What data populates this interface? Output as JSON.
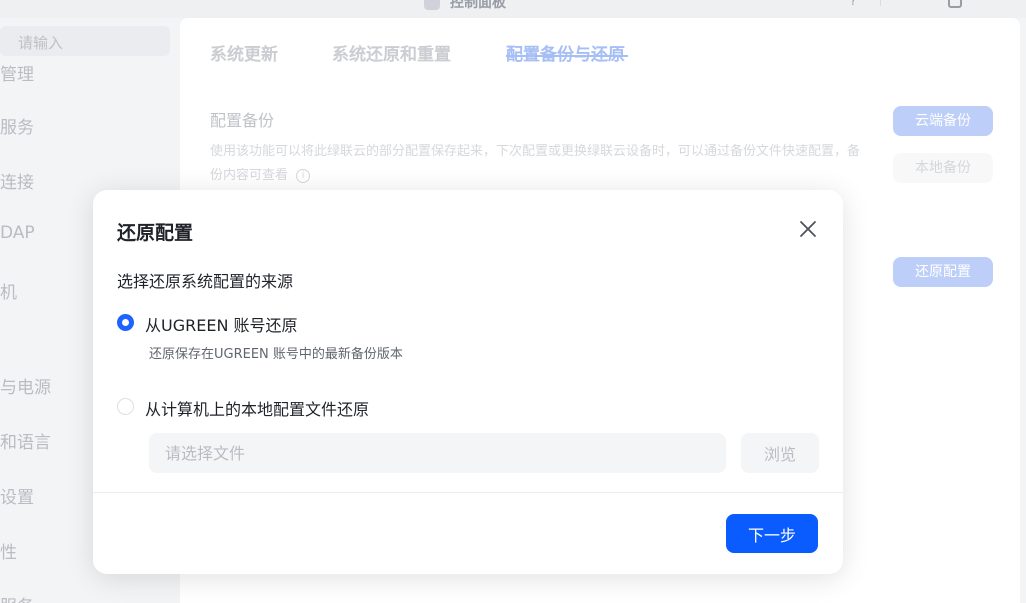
{
  "window": {
    "title": "控制面板"
  },
  "sidebar": {
    "search_placeholder": "请输入",
    "items": [
      {
        "label": "管理"
      },
      {
        "label": "服务"
      },
      {
        "label": "连接"
      },
      {
        "label": "DAP"
      },
      {
        "label": "机"
      },
      {
        "label": "与电源"
      },
      {
        "label": "和语言"
      },
      {
        "label": "设置"
      },
      {
        "label": "性"
      },
      {
        "label": "服务"
      }
    ]
  },
  "tabs": [
    {
      "label": "系统更新"
    },
    {
      "label": "系统还原和重置"
    },
    {
      "label": "配置备份与还原",
      "active": true
    }
  ],
  "backup": {
    "title": "配置备份",
    "description": "使用该功能可以将此绿联云的部分配置保存起来，下次配置或更换绿联云设备时，可以通过备份文件快速配置，备份内容可查看",
    "cloud_button": "云端备份",
    "local_button": "本地备份",
    "restore_button": "还原配置"
  },
  "modal": {
    "title": "还原配置",
    "subtitle": "选择还原系统配置的来源",
    "options": [
      {
        "label": "从UGREEN 账号还原",
        "description": "还原保存在UGREEN 账号中的最新备份版本",
        "checked": true
      },
      {
        "label": "从计算机上的本地配置文件还原",
        "checked": false
      }
    ],
    "file_placeholder": "请选择文件",
    "browse_label": "浏览",
    "next_label": "下一步"
  },
  "colors": {
    "accent": "#0b5cff",
    "accent_muted": "#b4c8f7",
    "text_primary": "#1f2329",
    "text_secondary": "#60656e"
  }
}
